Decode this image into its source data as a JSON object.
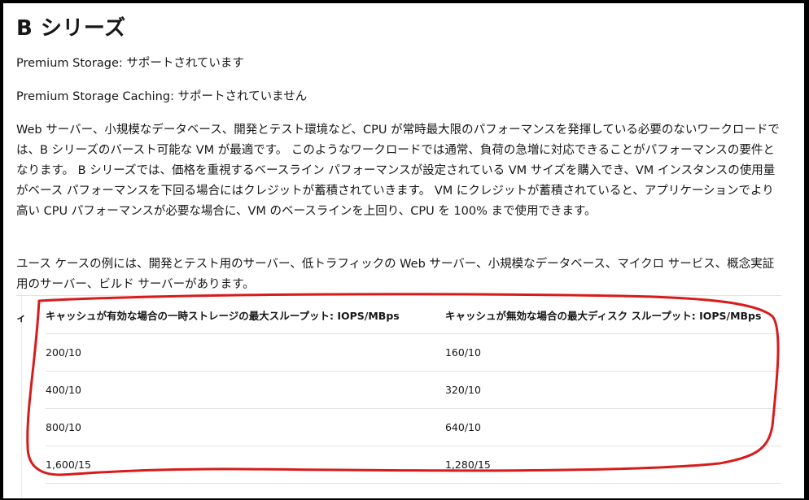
{
  "heading": "B シリーズ",
  "premium_storage": "Premium Storage: サポートされています",
  "premium_storage_caching": "Premium Storage Caching: サポートされていません",
  "description": "Web サーバー、小規模なデータベース、開発とテスト環境など、CPU が常時最大限のパフォーマンスを発揮している必要のないワークロードでは、B シリーズのバースト可能な VM が最適です。 このようなワークロードでは通常、負荷の急増に対応できることがパフォーマンスの要件となります。 B シリーズでは、価格を重視するベースライン パフォーマンスが設定されている VM サイズを購入でき、VM インスタンスの使用量がベース パフォーマンスを下回る場合にはクレジットが蓄積されていきます。 VM にクレジットが蓄積されていると、アプリケーションでより高い CPU パフォーマンスが必要な場合に、VM のベースラインを上回り、CPU を 100% まで使用できます。",
  "use_cases": "ユース ケースの例には、開発とテスト用のサーバー、低トラフィックの Web サーバー、小規模なデータベース、マイクロ サービス、概念実証用のサーバー、ビルド サーバーがあります。",
  "table": {
    "left_cut_header": "ィ",
    "headers": [
      "キャッシュが有効な場合の一時ストレージの最大スループット: IOPS/MBps",
      "キャッシュが無効な場合の最大ディスク スループット: IOPS/MBps"
    ],
    "rows": [
      [
        "200/10",
        "160/10"
      ],
      [
        "400/10",
        "320/10"
      ],
      [
        "800/10",
        "640/10"
      ],
      [
        "1,600/15",
        "1,280/15"
      ]
    ]
  },
  "annotation_color": "#d81b1b",
  "frame_color": "#000000"
}
